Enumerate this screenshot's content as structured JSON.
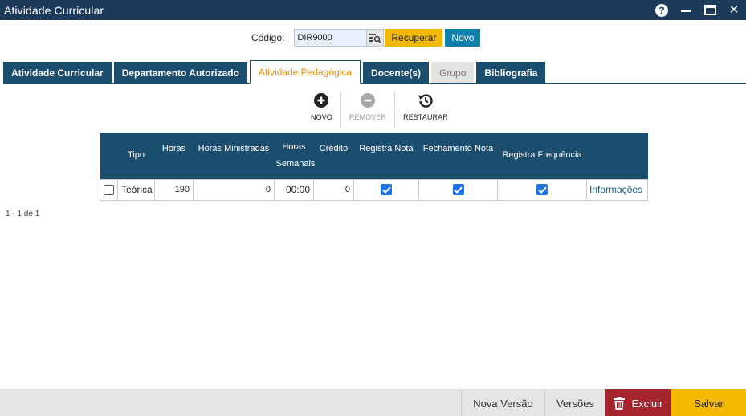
{
  "window": {
    "title": "Atividade Curricular"
  },
  "codigo": {
    "label": "Código:",
    "value": "DIR9000",
    "recuperar_label": "Recuperar",
    "novo_label": "Novo"
  },
  "tabs": [
    {
      "label": "Atividade Curricular",
      "state": "normal"
    },
    {
      "label": "Departamento Autorizado",
      "state": "normal"
    },
    {
      "label": "Atividade Pedagógica",
      "state": "active"
    },
    {
      "label": "Docente(s)",
      "state": "normal"
    },
    {
      "label": "Grupo",
      "state": "disabled"
    },
    {
      "label": "Bibliografia",
      "state": "normal"
    }
  ],
  "toolbar": {
    "novo": "NOVO",
    "remover": "REMOVER",
    "restaurar": "RESTAURAR"
  },
  "grid": {
    "columns": {
      "tipo": "Tipo",
      "horas": "Horas",
      "horas_ministradas": "Horas Ministradas",
      "horas_semanais_1": "Horas",
      "horas_semanais_2": "Semanais",
      "credito": "Crédito",
      "registra_nota": "Registra Nota",
      "fechamento_nota": "Fechamento Nota",
      "registra_frequencia": "Registra Frequência"
    },
    "rows": [
      {
        "selected": false,
        "tipo": "Teórica",
        "horas": "190",
        "horas_ministradas": "0",
        "horas_semanais": "00:00",
        "credito": "0",
        "registra_nota": true,
        "fechamento_nota": true,
        "registra_frequencia": true,
        "link": "Informações"
      }
    ]
  },
  "paging": "1 - 1 de 1",
  "footer": {
    "nova_versao": "Nova Versão",
    "versoes": "Versões",
    "excluir": "Excluir",
    "salvar": "Salvar"
  },
  "colors": {
    "titlebar": "#1b3a5c",
    "tab": "#1b4d6e",
    "active_tab_text": "#f08a00",
    "accent_yellow": "#f5b800",
    "accent_blue": "#0f7ea8",
    "danger": "#a5242d",
    "checkbox": "#1a73e8"
  }
}
